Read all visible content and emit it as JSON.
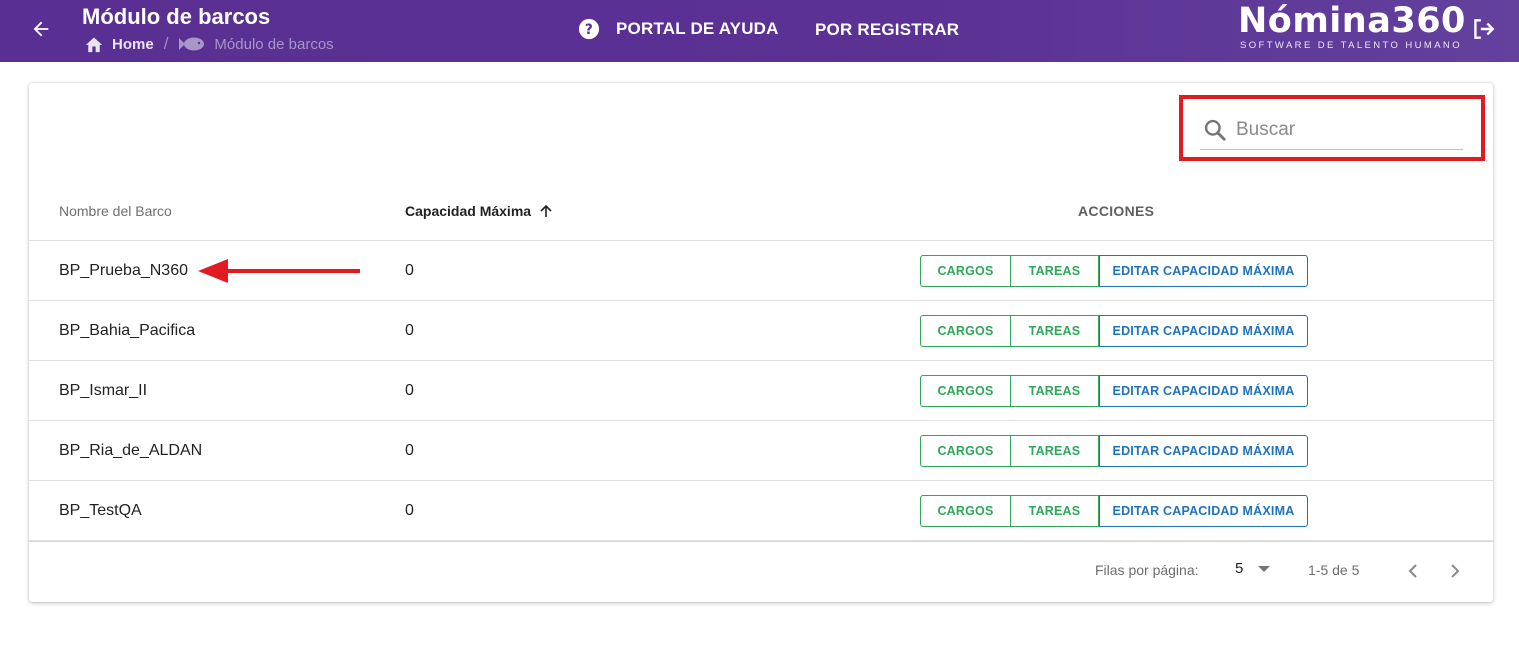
{
  "header": {
    "title": "Módulo de barcos",
    "breadcrumb": {
      "home": "Home",
      "current": "Módulo de barcos"
    },
    "nav": {
      "help": "PORTAL DE AYUDA",
      "register": "POR REGISTRAR"
    },
    "logo": {
      "main": "Nómina360",
      "sub": "SOFTWARE DE TALENTO HUMANO"
    },
    "icons": [
      "arrow-back-icon",
      "home-icon",
      "fish-icon",
      "help-circle-icon",
      "logout-icon"
    ]
  },
  "search": {
    "placeholder": "Buscar",
    "value": ""
  },
  "table": {
    "columns": {
      "name": "Nombre del Barco",
      "capacity": "Capacidad Máxima",
      "actions": "ACCIONES"
    },
    "sort": {
      "column": "capacity",
      "direction": "asc"
    },
    "action_labels": {
      "cargos": "CARGOS",
      "tareas": "TAREAS",
      "editar": "EDITAR CAPACIDAD MÁXIMA"
    },
    "rows": [
      {
        "name": "BP_Prueba_N360",
        "capacity": "0"
      },
      {
        "name": "BP_Bahia_Pacifica",
        "capacity": "0"
      },
      {
        "name": "BP_Ismar_II",
        "capacity": "0"
      },
      {
        "name": "BP_Ria_de_ALDAN",
        "capacity": "0"
      },
      {
        "name": "BP_TestQA",
        "capacity": "0"
      }
    ]
  },
  "pagination": {
    "rows_per_page_label": "Filas por página:",
    "rows_per_page": "5",
    "range": "1-5 de 5"
  },
  "colors": {
    "header": "#5a2f93",
    "green": "#2fa85a",
    "blue": "#1e73be",
    "annotation": "#e01b22"
  }
}
